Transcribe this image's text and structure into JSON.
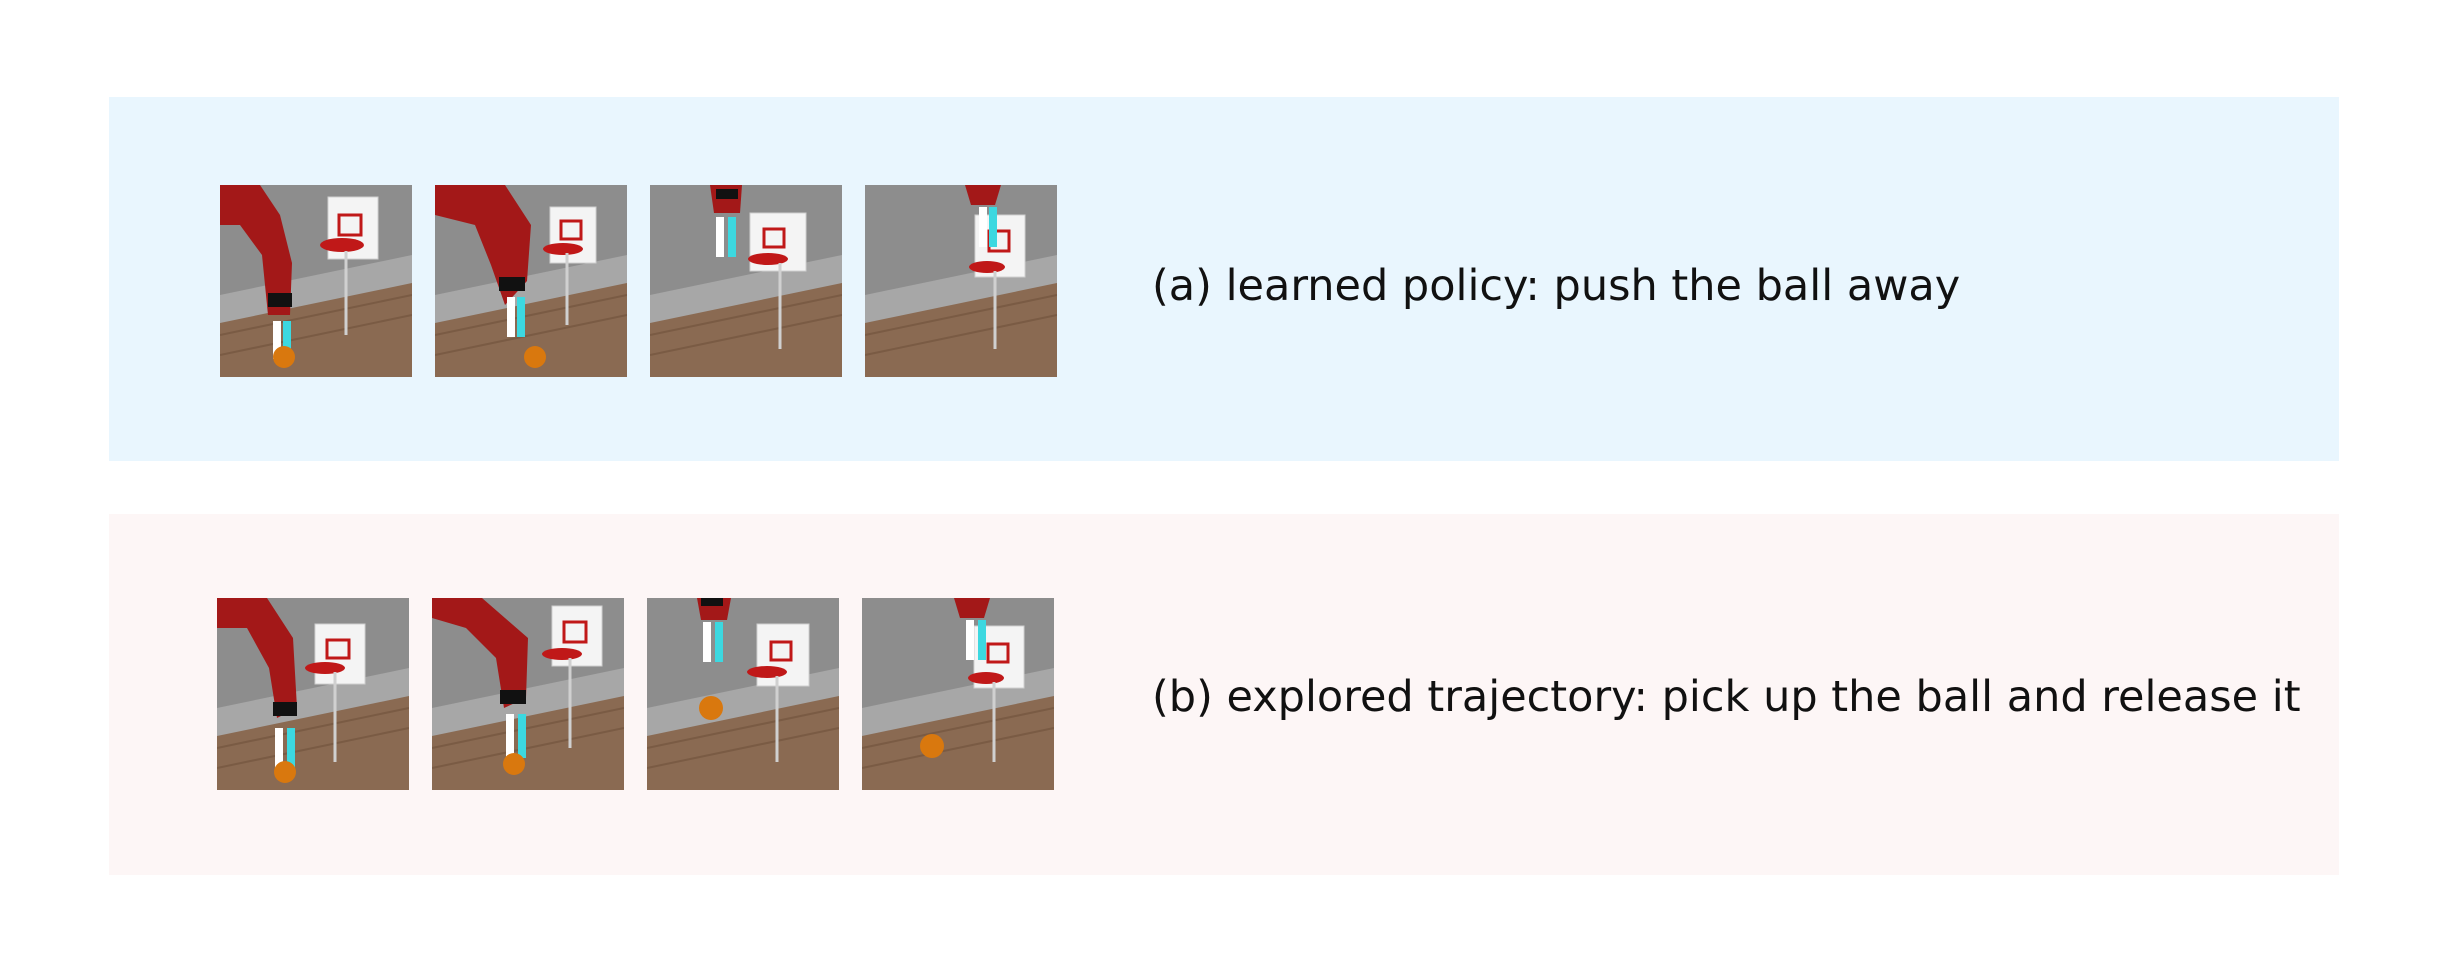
{
  "rows": [
    {
      "caption": "(a) learned policy: push the ball away",
      "background": "#e9f6fe",
      "frames": [
        {
          "scene": "arm-low-grasp-ball"
        },
        {
          "scene": "arm-low-ball-pushed"
        },
        {
          "scene": "arm-raised-near-hoop"
        },
        {
          "scene": "arm-above-hoop"
        }
      ]
    },
    {
      "caption": "(b) explored trajectory: pick up the ball and release it",
      "background": "#fdf6f6",
      "frames": [
        {
          "scene": "arm-low-grasp-ball"
        },
        {
          "scene": "arm-lift-ball"
        },
        {
          "scene": "arm-release-ball"
        },
        {
          "scene": "arm-above-hoop-ball-dropped"
        }
      ]
    }
  ]
}
